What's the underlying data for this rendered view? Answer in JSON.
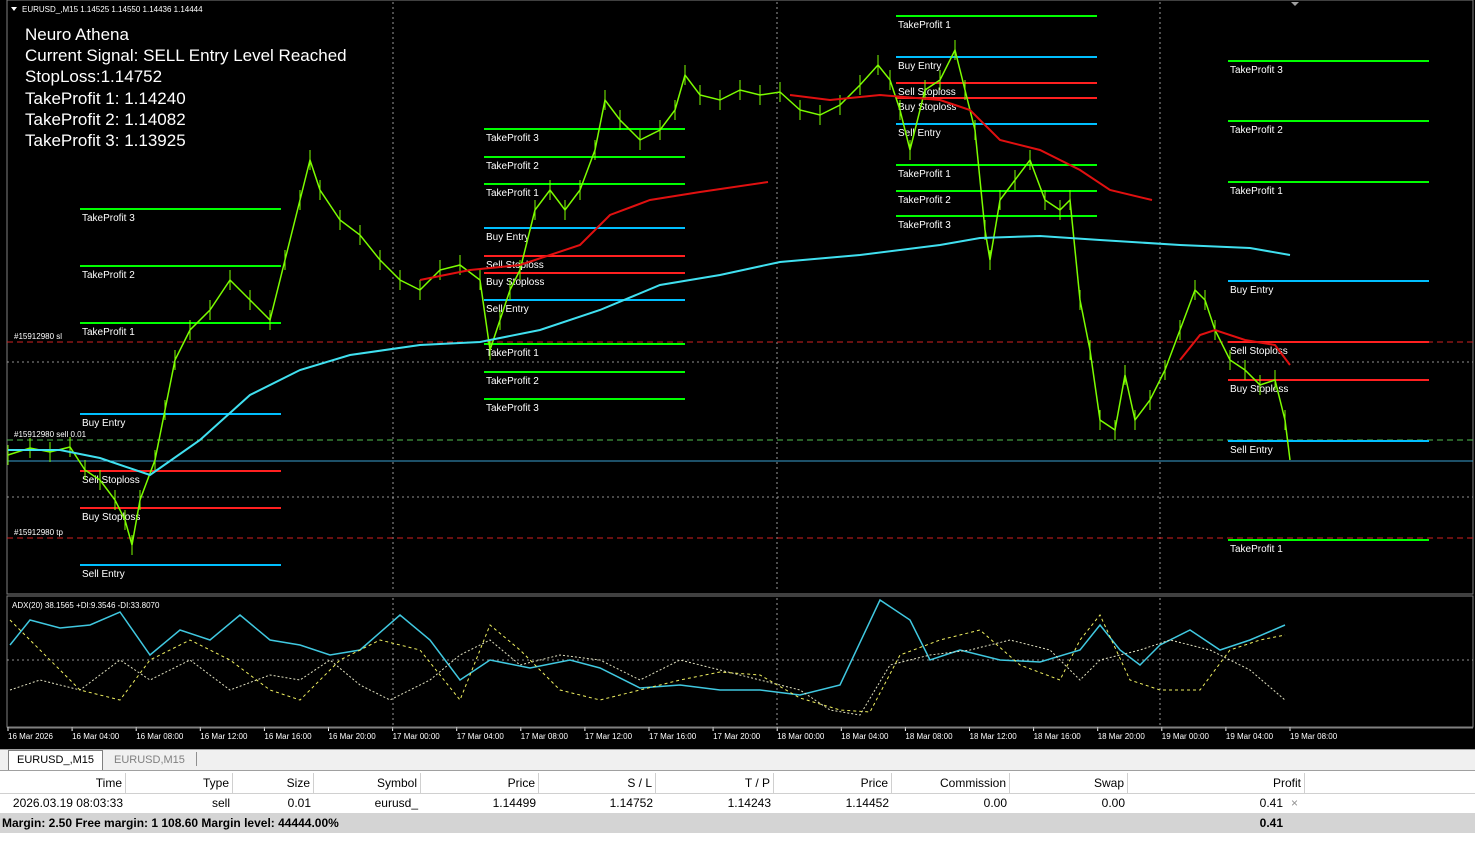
{
  "chart": {
    "header": "EURUSD_,M15  1.14525 1.14550 1.14436 1.14444",
    "indicator_text": {
      "title": "Neuro Athena",
      "signal": "Current Signal: SELL Entry Level Reached",
      "stoploss": "StopLoss:1.14752",
      "tp1": "TakeProfit 1: 1.14240",
      "tp2": "TakeProfit 2: 1.14082",
      "tp3": "TakeProfit 3: 1.13925"
    },
    "order_labels": {
      "sl": "#15912980 sl",
      "order": "#15912980 sell 0.01",
      "tp": "#15912980 tp"
    },
    "level_labels": {
      "tp1": "TakeProfit 1",
      "tp2": "TakeProfit 2",
      "tp3": "TakeProfit 3",
      "buy_entry": "Buy Entry",
      "sell_entry": "Sell Entry",
      "sell_stoploss": "Sell Stoploss",
      "buy_stoploss": "Buy Stoploss"
    },
    "adx_header": "ADX(20) 38.1565 +DI:9.3546 -DI:33.8070",
    "time_labels": [
      "16 Mar 2026",
      "16 Mar 04:00",
      "16 Mar 08:00",
      "16 Mar 12:00",
      "16 Mar 16:00",
      "16 Mar 20:00",
      "17 Mar 00:00",
      "17 Mar 04:00",
      "17 Mar 08:00",
      "17 Mar 12:00",
      "17 Mar 16:00",
      "17 Mar 20:00",
      "18 Mar 00:00",
      "18 Mar 04:00",
      "18 Mar 08:00",
      "18 Mar 12:00",
      "18 Mar 16:00",
      "18 Mar 20:00",
      "19 Mar 00:00",
      "19 Mar 04:00",
      "19 Mar 08:00"
    ],
    "colors": {
      "background": "#000000",
      "candles": "#7cfc00",
      "take_profit": "#00ff00",
      "entry": "#00bfff",
      "stoploss": "#ff2020",
      "ma_slow": "#40e0f0",
      "ma_fast": "#e01010",
      "grid": "#c0c0c0"
    }
  },
  "tabs": [
    {
      "label": "EURUSD_,M15",
      "active": true
    },
    {
      "label": "EURUSD,M15",
      "active": false
    }
  ],
  "trade_table": {
    "headers": [
      "Time",
      "Type",
      "Size",
      "Symbol",
      "Price",
      "S / L",
      "T / P",
      "Price",
      "Commission",
      "Swap",
      "Profit"
    ],
    "row": [
      "2026.03.19 08:03:33",
      "sell",
      "0.01",
      "eurusd_",
      "1.14499",
      "1.14752",
      "1.14243",
      "1.14452",
      "0.00",
      "0.00",
      "0.41"
    ],
    "close_icon": "×",
    "summary_text": "Margin: 2.50  Free margin: 1 108.60  Margin level: 44444.00%",
    "summary_profit": "0.41"
  }
}
